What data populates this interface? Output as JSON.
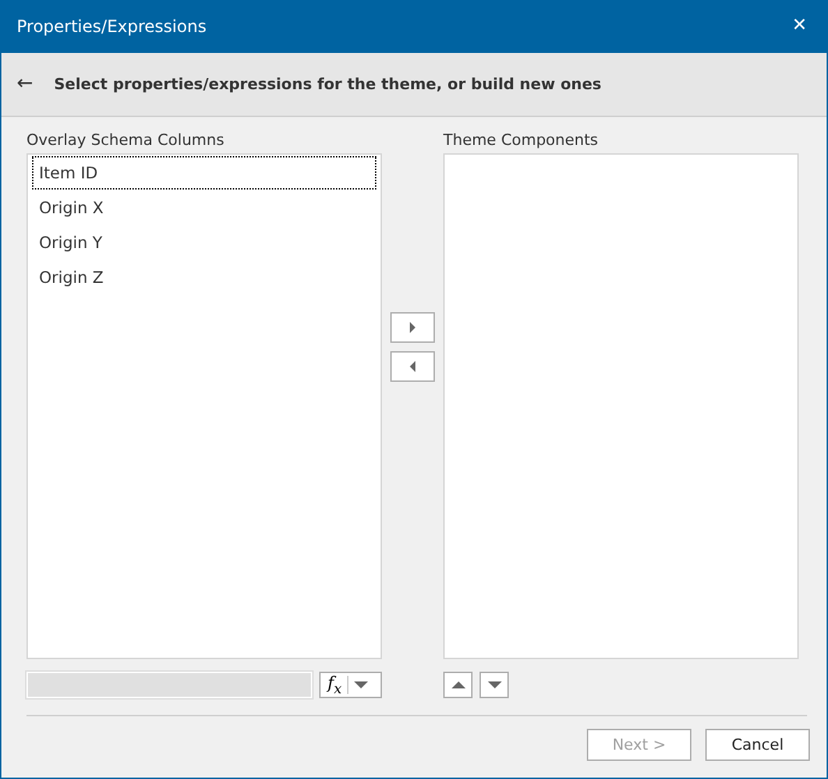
{
  "window": {
    "title": "Properties/Expressions",
    "close": "✕"
  },
  "header": {
    "back": "←",
    "instruction": "Select properties/expressions for the theme, or build new ones"
  },
  "overlay_columns": {
    "label": "Overlay Schema Columns",
    "items": [
      {
        "label": "Item ID",
        "selected": true
      },
      {
        "label": "Origin X",
        "selected": false
      },
      {
        "label": "Origin Y",
        "selected": false
      },
      {
        "label": "Origin Z",
        "selected": false
      }
    ]
  },
  "formula_button": {
    "label": "f$_{x}$"
  },
  "theme_components": {
    "label": "Theme Components"
  },
  "buttons": [
    {
      "label": "Next >",
      "disabled": true
    },
    {
      "label": "Cancel",
      "disabled": false
    }
  ]
}
